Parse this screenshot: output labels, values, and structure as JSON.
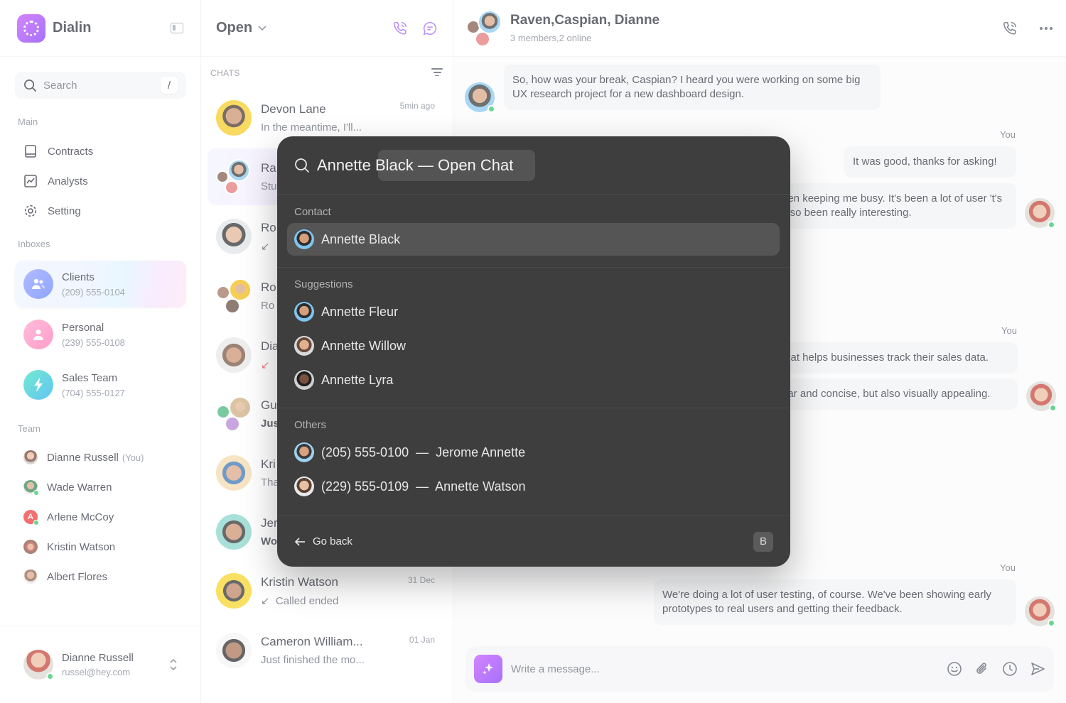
{
  "brand": {
    "name": "Dialin"
  },
  "sidebar": {
    "search_label": "Search",
    "search_shortcut": "/",
    "main_label": "Main",
    "main_items": [
      {
        "label": "Contracts",
        "icon": "document-icon"
      },
      {
        "label": "Analysts",
        "icon": "chart-icon"
      },
      {
        "label": "Setting",
        "icon": "gear-icon"
      }
    ],
    "inboxes_label": "Inboxes",
    "inboxes": [
      {
        "name": "Clients",
        "phone": "(209) 555-0104",
        "color": "#6a8dff",
        "active": true
      },
      {
        "name": "Personal",
        "phone": "(239) 555-0108",
        "color": "#ff6fb1"
      },
      {
        "name": "Sales Team",
        "phone": "(704) 555-0127",
        "color": "#22c4d6"
      }
    ],
    "team_label": "Team",
    "team": [
      {
        "name": "Dianne Russell",
        "tag": "(You)"
      },
      {
        "name": "Wade Warren"
      },
      {
        "name": "Arlene McCoy",
        "initial": "A"
      },
      {
        "name": "Kristin Watson"
      },
      {
        "name": "Albert Flores"
      }
    ],
    "profile": {
      "name": "Dianne Russell",
      "email": "russel@hey.com"
    }
  },
  "chatlist": {
    "title": "Open",
    "section": "CHATS",
    "chats": [
      {
        "name": "Devon Lane",
        "preview": "In the meantime, I'll...",
        "time": "5min ago"
      },
      {
        "name": "Ra",
        "preview": "Stu",
        "active": true
      },
      {
        "name": "Ro",
        "preview": ""
      },
      {
        "name": "Ro",
        "preview": "Ro"
      },
      {
        "name": "Dia",
        "preview": ""
      },
      {
        "name": "Gu",
        "preview": "Jus"
      },
      {
        "name": "Kri",
        "preview": "Tha"
      },
      {
        "name": "Jer",
        "preview": "Wo"
      },
      {
        "name": "Kristin Watson",
        "preview": "Called ended",
        "time": "31 Dec"
      },
      {
        "name": "Cameron William...",
        "preview": "Just finished the mo...",
        "time": "01 Jan"
      }
    ]
  },
  "conversation": {
    "title": "Raven,Caspian, Dianne",
    "subtitle": "3 members,2 online",
    "messages": [
      {
        "text": "So, how was your break, Caspian? I heard you were working on some big UX research project for a new dashboard design."
      },
      {
        "label": "You",
        "text": "It was good, thanks for asking!"
      },
      {
        "text": "een keeping me busy. It's been a lot of user 't's also been really interesting."
      },
      {
        "label": "You",
        "text": "that helps businesses track their sales data."
      },
      {
        "text": "ear and concise, but also visually appealing."
      },
      {
        "label": "You",
        "text": "We're doing a lot of user testing, of course. We've been showing early prototypes to real users and getting their feedback."
      }
    ],
    "composer_placeholder": "Write a message..."
  },
  "palette": {
    "query": "Annette Black  —  Open Chat",
    "contact_label": "Contact",
    "contact": "Annette Black",
    "suggestions_label": "Suggestions",
    "suggestions": [
      "Annette Fleur",
      "Annette Willow",
      "Annette Lyra"
    ],
    "others_label": "Others",
    "others": [
      "(205) 555-0100  —  Jerome Annette",
      "(229) 555-0109  —  Annette Watson"
    ],
    "back_label": "Go back",
    "back_shortcut": "B"
  }
}
